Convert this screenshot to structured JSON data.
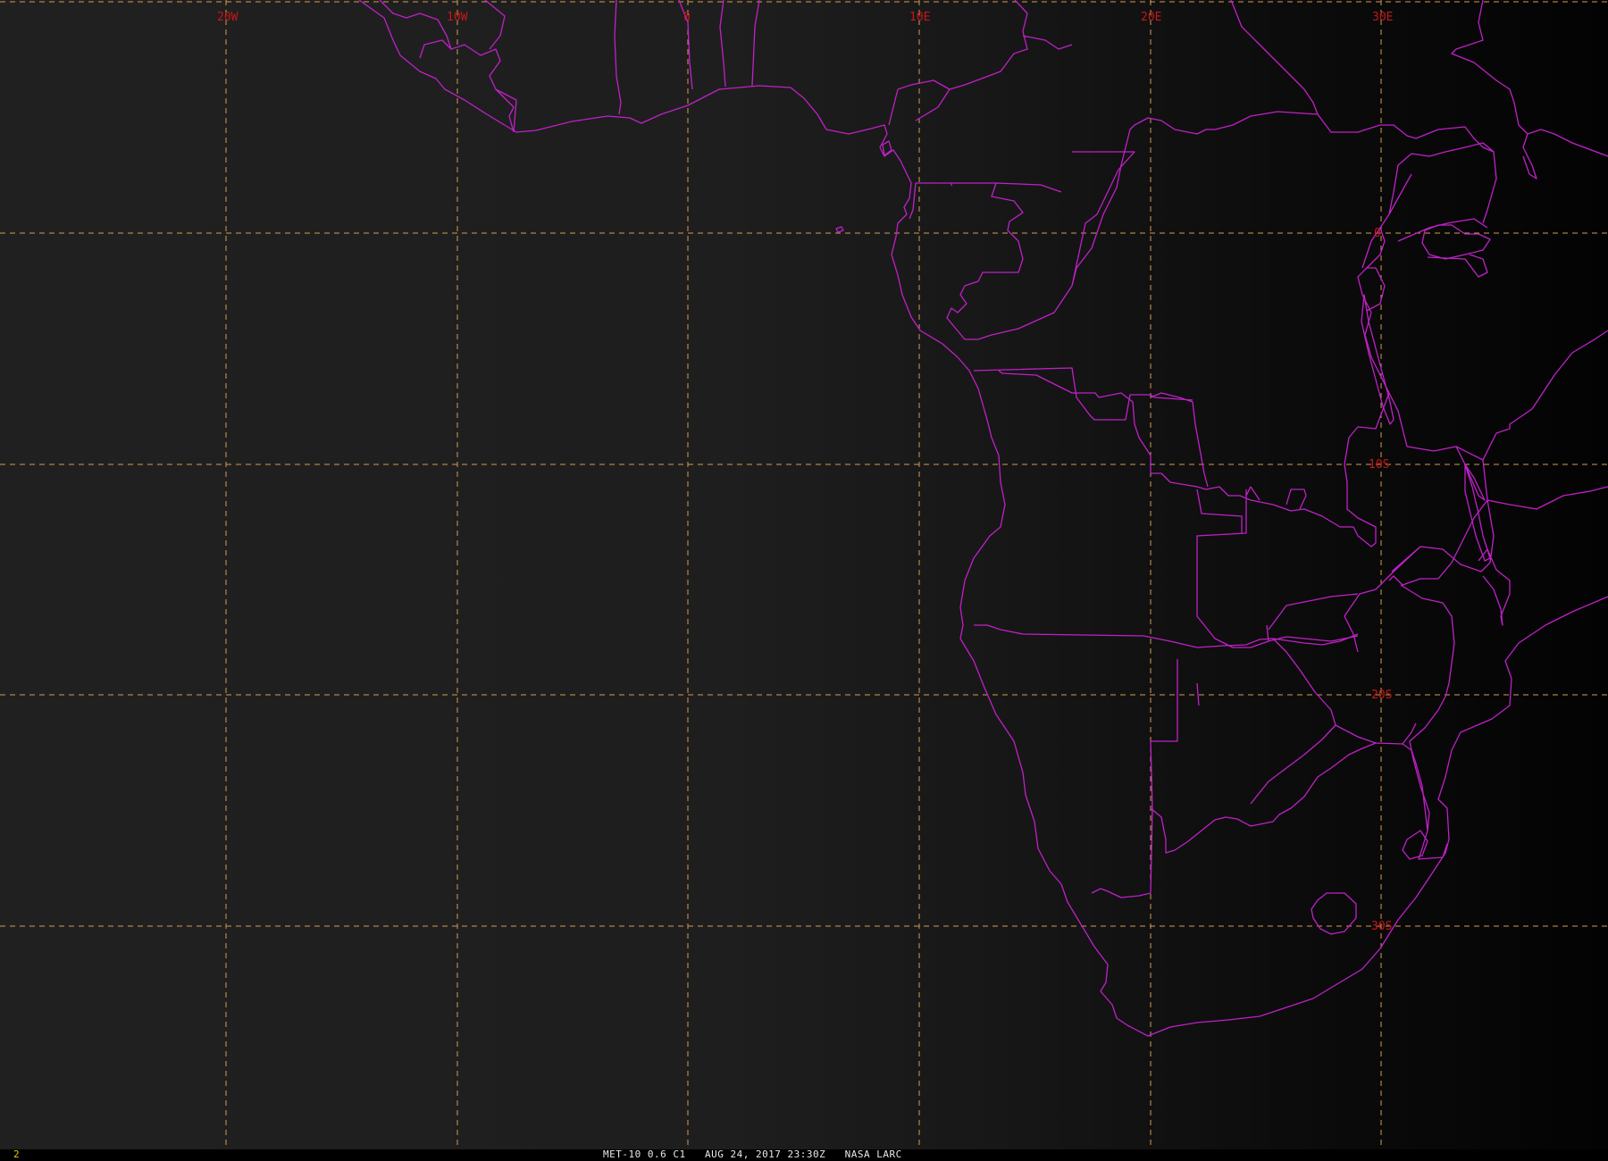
{
  "image": {
    "caption": "MET-10 0.6 C1   AUG 24, 2017 23:30Z   NASA LARC",
    "frame_number": "2"
  },
  "map": {
    "projection_center": "0 / 0",
    "grid_color": "#d49a52",
    "border_color": "#c020c8",
    "label_color": "#c41818",
    "longitude_labels": [
      "20W",
      "10W",
      "0",
      "10E",
      "20E",
      "30E"
    ],
    "latitude_labels": [
      "0",
      "10S",
      "20S",
      "30S"
    ],
    "region_shown": "West, Central and Southern Africa with Atlantic Ocean"
  }
}
